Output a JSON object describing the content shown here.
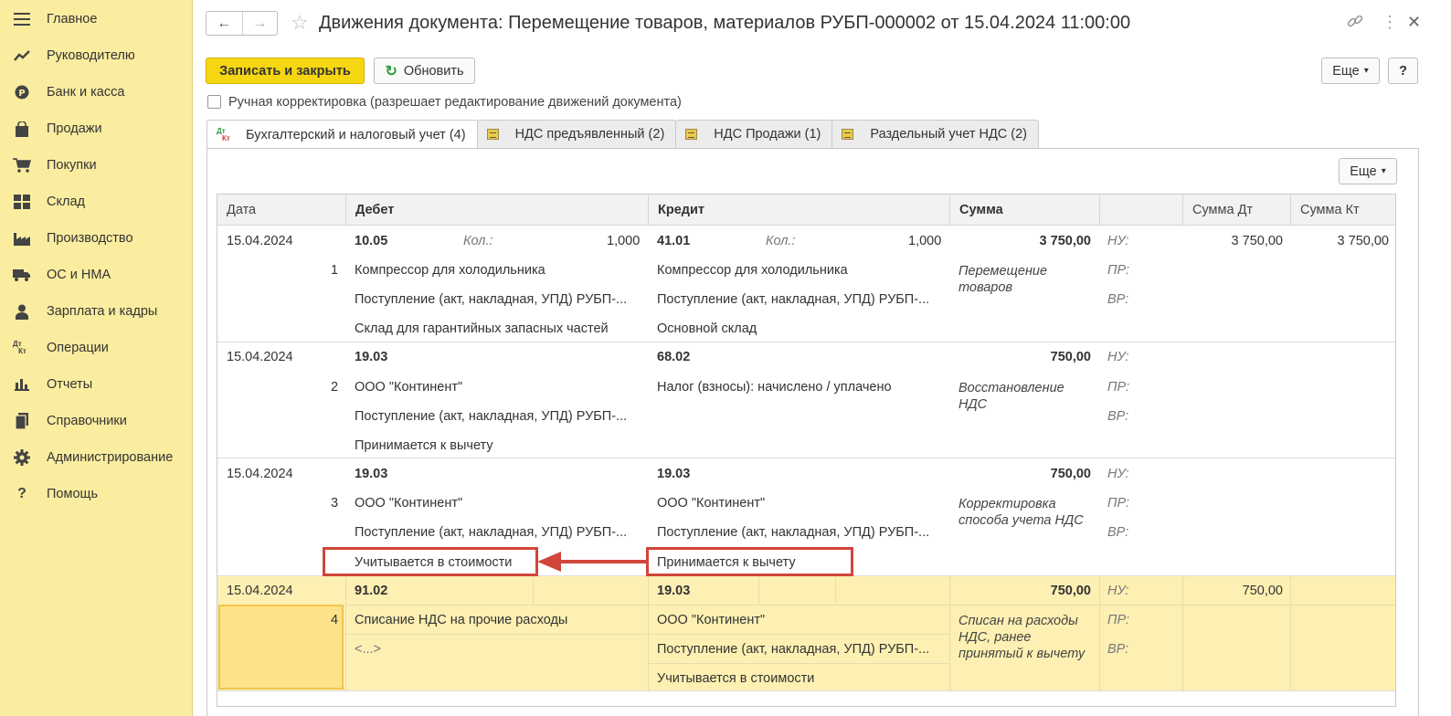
{
  "sidebar": {
    "items": [
      {
        "label": "Главное",
        "icon": "menu-icon"
      },
      {
        "label": "Руководителю",
        "icon": "trend-icon"
      },
      {
        "label": "Банк и касса",
        "icon": "coin-icon"
      },
      {
        "label": "Продажи",
        "icon": "bag-icon"
      },
      {
        "label": "Покупки",
        "icon": "cart-icon"
      },
      {
        "label": "Склад",
        "icon": "warehouse-icon"
      },
      {
        "label": "Производство",
        "icon": "factory-icon"
      },
      {
        "label": "ОС и НМА",
        "icon": "truck-icon"
      },
      {
        "label": "Зарплата и кадры",
        "icon": "person-icon"
      },
      {
        "label": "Операции",
        "icon": "dt-kt-icon"
      },
      {
        "label": "Отчеты",
        "icon": "bar-chart-icon"
      },
      {
        "label": "Справочники",
        "icon": "books-icon"
      },
      {
        "label": "Администрирование",
        "icon": "gear-icon"
      },
      {
        "label": "Помощь",
        "icon": "help-icon"
      }
    ]
  },
  "header": {
    "back": "←",
    "forward": "→",
    "star": "☆",
    "title": "Движения документа: Перемещение товаров, материалов РУБП-000002 от 15.04.2024 11:00:00",
    "link_icon": "⚔",
    "more_icon": "⋮",
    "close_icon": "✕"
  },
  "toolbar": {
    "save_close": "Записать и закрыть",
    "refresh": "Обновить",
    "refresh_icon": "↻",
    "more": "Еще",
    "help": "?",
    "dropdown_arrow": "▾"
  },
  "manual_correction": "Ручная корректировка (разрешает редактирование движений документа)",
  "tabs": [
    {
      "label": "Бухгалтерский и налоговый учет (4)",
      "active": true
    },
    {
      "label": "НДС предъявленный (2)",
      "active": false
    },
    {
      "label": "НДС Продажи (1)",
      "active": false
    },
    {
      "label": "Раздельный учет НДС (2)",
      "active": false
    }
  ],
  "tab_icon_dt": "Дт",
  "tab_icon_kt": "Кт",
  "panel_more": "Еще",
  "table": {
    "columns": [
      "Дата",
      "Дебет",
      "Кредит",
      "Сумма",
      "",
      "Сумма Дт",
      "Сумма Кт"
    ],
    "qty_label": "Кол.:",
    "nu": "НУ:",
    "pr": "ПР:",
    "vr": "ВР:",
    "rows": [
      {
        "date": "15.04.2024",
        "num": "1",
        "debit_account": "10.05",
        "debit_qty": "1,000",
        "debit_sub": [
          "Компрессор для холодильника",
          "Поступление (акт, накладная, УПД) РУБП-...",
          "Склад для гарантийных запасных частей"
        ],
        "credit_account": "41.01",
        "credit_qty": "1,000",
        "credit_sub": [
          "Компрессор для холодильника",
          "Поступление (акт, накладная, УПД) РУБП-...",
          "Основной склад"
        ],
        "amount": "3 750,00",
        "content": "Перемещение товаров",
        "sum_dt": "3 750,00",
        "sum_kt": "3 750,00"
      },
      {
        "date": "15.04.2024",
        "num": "2",
        "debit_account": "19.03",
        "debit_sub": [
          "ООО \"Континент\"",
          "Поступление (акт, накладная, УПД) РУБП-...",
          "Принимается к вычету"
        ],
        "credit_account": "68.02",
        "credit_sub": [
          "Налог (взносы): начислено / уплачено"
        ],
        "amount": "750,00",
        "content": "Восстановление НДС"
      },
      {
        "date": "15.04.2024",
        "num": "3",
        "debit_account": "19.03",
        "debit_sub": [
          "ООО \"Континент\"",
          "Поступление (акт, накладная, УПД) РУБП-...",
          "Учитывается в стоимости"
        ],
        "credit_account": "19.03",
        "credit_sub": [
          "ООО \"Континент\"",
          "Поступление (акт, накладная, УПД) РУБП-...",
          "Принимается к вычету"
        ],
        "amount": "750,00",
        "content": "Корректировка способа учета НДС"
      },
      {
        "date": "15.04.2024",
        "num": "4",
        "debit_account": "91.02",
        "debit_sub": [
          "Списание НДС на прочие расходы",
          "<...>"
        ],
        "credit_account": "19.03",
        "credit_sub": [
          "ООО \"Континент\"",
          "Поступление (акт, накладная, УПД) РУБП-...",
          "Учитывается в стоимости"
        ],
        "amount": "750,00",
        "content": "Списан на расходы НДС, ранее принятый к вычету",
        "sum_dt": "750,00"
      }
    ]
  },
  "colors": {
    "sidebar_bg": "#fbeda0",
    "primary_button": "#f6d611",
    "selected_row": "#fdf0b2",
    "annotation": "#d2453b"
  }
}
